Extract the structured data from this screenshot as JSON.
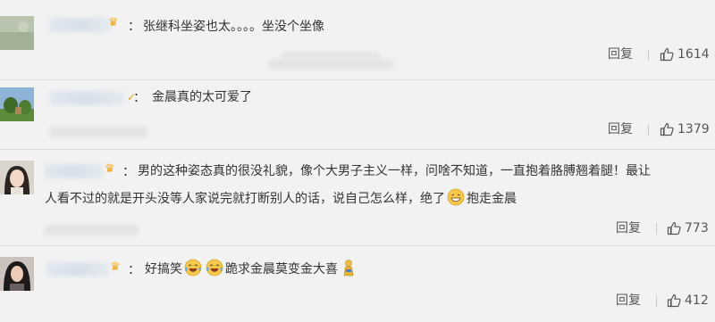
{
  "comments": [
    {
      "text": "张继科坐姿也太。。。。坐没个坐像",
      "reply_label": "回复",
      "likes": "1614",
      "badge": "crown-badge-icon"
    },
    {
      "text": "金晨真的太可爱了",
      "reply_label": "回复",
      "likes": "1379",
      "badge": "verified-v-icon"
    },
    {
      "text_line1": "男的这种姿态真的很没礼貌，像个大男子主义一样，问啥不知道，一直抱着胳膊翘着腿！最让",
      "text_line2a": "人看不过的就是开头没等人家说完就打断别人的话，说自己怎么样，绝了",
      "text_line2b": "抱走金晨",
      "reply_label": "回复",
      "likes": "773",
      "badge": "crown-badge-icon"
    },
    {
      "text_a": "好搞笑",
      "text_b": "跪求金晨莫变金大喜",
      "reply_label": "回复",
      "likes": "412",
      "badge": "crown-badge-icon"
    }
  ],
  "colors": {
    "background": "#f2f2f2",
    "text": "#333333",
    "meta": "#555555",
    "crown": "#f5a623",
    "separator": "#dcdcdc"
  }
}
